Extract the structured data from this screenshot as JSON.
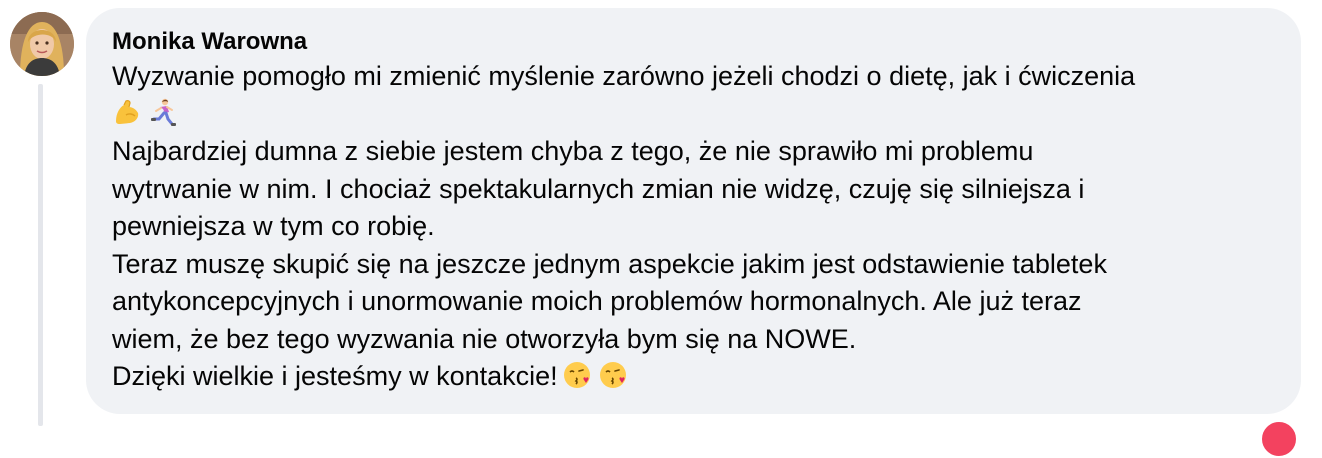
{
  "comment": {
    "author": "Monika Warowna",
    "lines": [
      "Wyzwanie pomogło mi zmienić myślenie zarówno jeżeli chodzi o dietę, jak i ćwiczenia",
      "Najbardziej dumna z siebie jestem chyba z tego, że nie sprawiło mi problemu",
      "wytrwanie w nim. I chociaż spektakularnych zmian nie widzę, czuję się silniejsza i",
      "pewniejsza w tym co robię.",
      "Teraz muszę skupić się na jeszcze jednym aspekcie jakim jest odstawienie tabletek",
      "antykoncepcyjnych i unormowanie moich problemów hormonalnych. Ale już teraz",
      "wiem, że bez tego wyzwania nie otworzyła bym się na NOWE.",
      "Dzięki wielkie i jesteśmy w kontakcie!"
    ],
    "emoji_row_1": [
      "flexed-biceps-emoji",
      "person-running-emoji"
    ],
    "emoji_row_2": [
      "face-blowing-kiss-emoji",
      "face-blowing-kiss-emoji"
    ]
  },
  "colors": {
    "bubble_bg": "#f0f2f5",
    "text": "#050505",
    "thread_line": "#e4e6eb",
    "reaction": "#f3425f"
  }
}
